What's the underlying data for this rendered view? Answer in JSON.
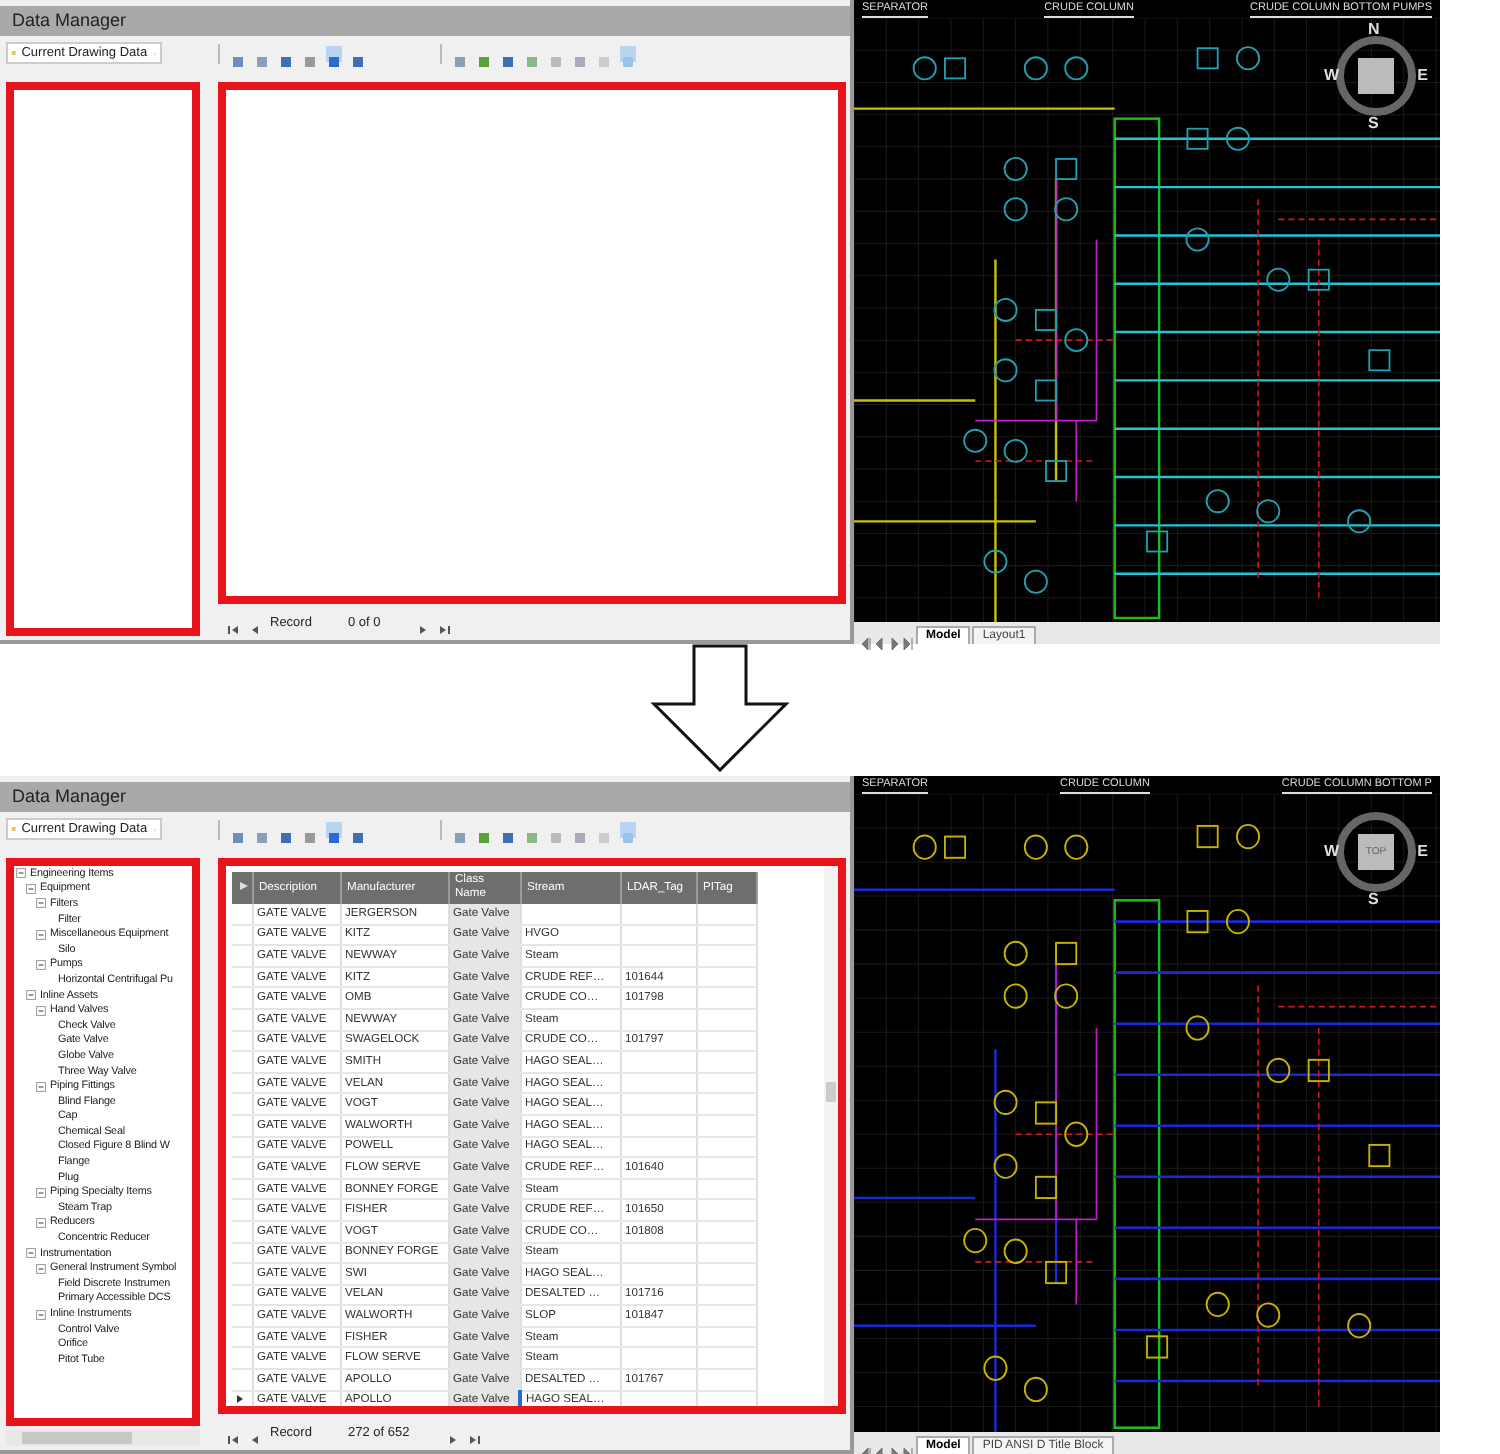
{
  "screens": [
    {
      "window": {
        "title": "Data Manager"
      },
      "source_dropdown": {
        "value": "Current Drawing Data"
      },
      "record_nav": {
        "label": "Record",
        "position": "0 of 0"
      },
      "drawing": {
        "titles": [
          "SEPARATOR",
          "CRUDE COLUMN",
          "CRUDE COLUMN BOTTOM PUMPS"
        ],
        "compass": {
          "n": "N",
          "e": "E",
          "s": "S",
          "w": "W"
        },
        "layout_tabs": [
          {
            "label": "Model",
            "selected": true
          },
          {
            "label": "Layout1",
            "selected": false
          }
        ]
      }
    },
    {
      "window": {
        "title": "Data Manager"
      },
      "source_dropdown": {
        "value": "Current Drawing Data"
      },
      "tree": [
        {
          "label": "Engineering Items",
          "expanded": true,
          "children": [
            {
              "label": "Equipment",
              "expanded": true,
              "children": [
                {
                  "label": "Filters",
                  "expanded": true,
                  "children": [
                    {
                      "label": "Filter"
                    }
                  ]
                },
                {
                  "label": "Miscellaneous Equipment",
                  "expanded": true,
                  "children": [
                    {
                      "label": "Silo"
                    }
                  ]
                },
                {
                  "label": "Pumps",
                  "expanded": true,
                  "children": [
                    {
                      "label": "Horizontal Centrifugal Pu"
                    }
                  ]
                }
              ]
            },
            {
              "label": "Inline Assets",
              "expanded": true,
              "children": [
                {
                  "label": "Hand Valves",
                  "expanded": true,
                  "children": [
                    {
                      "label": "Check Valve"
                    },
                    {
                      "label": "Gate Valve"
                    },
                    {
                      "label": "Globe Valve"
                    },
                    {
                      "label": "Three Way Valve"
                    }
                  ]
                },
                {
                  "label": "Piping Fittings",
                  "expanded": true,
                  "children": [
                    {
                      "label": "Blind Flange"
                    },
                    {
                      "label": "Cap"
                    },
                    {
                      "label": "Chemical Seal"
                    },
                    {
                      "label": "Closed Figure 8 Blind W"
                    },
                    {
                      "label": "Flange"
                    },
                    {
                      "label": "Plug"
                    }
                  ]
                },
                {
                  "label": "Piping Specialty Items",
                  "expanded": true,
                  "children": [
                    {
                      "label": "Steam Trap"
                    }
                  ]
                },
                {
                  "label": "Reducers",
                  "expanded": true,
                  "children": [
                    {
                      "label": "Concentric Reducer"
                    }
                  ]
                }
              ]
            },
            {
              "label": "Instrumentation",
              "expanded": true,
              "children": [
                {
                  "label": "General Instrument Symbol",
                  "expanded": true,
                  "children": [
                    {
                      "label": "Field Discrete Instrumen"
                    },
                    {
                      "label": "Primary Accessible DCS"
                    }
                  ]
                },
                {
                  "label": "Inline Instruments",
                  "expanded": true,
                  "children": [
                    {
                      "label": "Control Valve"
                    },
                    {
                      "label": "Orifice"
                    },
                    {
                      "label": "Pitot Tube"
                    }
                  ]
                }
              ]
            }
          ]
        }
      ],
      "table": {
        "columns": [
          "Description",
          "Manufacturer",
          "Class Name",
          "Stream",
          "LDAR_Tag",
          "PITag"
        ],
        "rows": [
          {
            "cells": [
              "GATE VALVE",
              "JERGERSON",
              "Gate Valve",
              "",
              "",
              ""
            ],
            "selected": false
          },
          {
            "cells": [
              "GATE VALVE",
              "KITZ",
              "Gate Valve",
              "HVGO",
              "",
              ""
            ],
            "selected": false
          },
          {
            "cells": [
              "GATE VALVE",
              "NEWWAY",
              "Gate Valve",
              "Steam",
              "",
              ""
            ],
            "selected": false
          },
          {
            "cells": [
              "GATE VALVE",
              "KITZ",
              "Gate Valve",
              "CRUDE REF…",
              "101644",
              ""
            ],
            "selected": false
          },
          {
            "cells": [
              "GATE VALVE",
              "OMB",
              "Gate Valve",
              "CRUDE CO…",
              "101798",
              ""
            ],
            "selected": false
          },
          {
            "cells": [
              "GATE VALVE",
              "NEWWAY",
              "Gate Valve",
              "Steam",
              "",
              ""
            ],
            "selected": false
          },
          {
            "cells": [
              "GATE VALVE",
              "SWAGELOCK",
              "Gate Valve",
              "CRUDE CO…",
              "101797",
              ""
            ],
            "selected": false
          },
          {
            "cells": [
              "GATE VALVE",
              "SMITH",
              "Gate Valve",
              "HAGO SEAL…",
              "",
              ""
            ],
            "selected": false
          },
          {
            "cells": [
              "GATE VALVE",
              "VELAN",
              "Gate Valve",
              "HAGO SEAL…",
              "",
              ""
            ],
            "selected": false
          },
          {
            "cells": [
              "GATE VALVE",
              "VOGT",
              "Gate Valve",
              "HAGO SEAL…",
              "",
              ""
            ],
            "selected": false
          },
          {
            "cells": [
              "GATE VALVE",
              "WALWORTH",
              "Gate Valve",
              "HAGO SEAL…",
              "",
              ""
            ],
            "selected": false
          },
          {
            "cells": [
              "GATE VALVE",
              "POWELL",
              "Gate Valve",
              "HAGO SEAL…",
              "",
              ""
            ],
            "selected": false
          },
          {
            "cells": [
              "GATE VALVE",
              "FLOW SERVE",
              "Gate Valve",
              "CRUDE REF…",
              "101640",
              ""
            ],
            "selected": false
          },
          {
            "cells": [
              "GATE VALVE",
              "BONNEY FORGE",
              "Gate Valve",
              "Steam",
              "",
              ""
            ],
            "selected": false
          },
          {
            "cells": [
              "GATE VALVE",
              "FISHER",
              "Gate Valve",
              "CRUDE REF…",
              "101650",
              ""
            ],
            "selected": false
          },
          {
            "cells": [
              "GATE VALVE",
              "VOGT",
              "Gate Valve",
              "CRUDE CO…",
              "101808",
              ""
            ],
            "selected": false
          },
          {
            "cells": [
              "GATE VALVE",
              "BONNEY FORGE",
              "Gate Valve",
              "Steam",
              "",
              ""
            ],
            "selected": false
          },
          {
            "cells": [
              "GATE VALVE",
              "SWI",
              "Gate Valve",
              "HAGO SEAL…",
              "",
              ""
            ],
            "selected": false
          },
          {
            "cells": [
              "GATE VALVE",
              "VELAN",
              "Gate Valve",
              "DESALTED …",
              "101716",
              ""
            ],
            "selected": false
          },
          {
            "cells": [
              "GATE VALVE",
              "WALWORTH",
              "Gate Valve",
              "SLOP",
              "101847",
              ""
            ],
            "selected": false
          },
          {
            "cells": [
              "GATE VALVE",
              "FISHER",
              "Gate Valve",
              "Steam",
              "",
              ""
            ],
            "selected": false
          },
          {
            "cells": [
              "GATE VALVE",
              "FLOW SERVE",
              "Gate Valve",
              "Steam",
              "",
              ""
            ],
            "selected": false
          },
          {
            "cells": [
              "GATE VALVE",
              "APOLLO",
              "Gate Valve",
              "DESALTED …",
              "101767",
              ""
            ],
            "selected": false
          },
          {
            "cells": [
              "GATE VALVE",
              "APOLLO",
              "Gate Valve",
              "HAGO SEAL…",
              "",
              ""
            ],
            "selected": true
          }
        ]
      },
      "record_nav": {
        "label": "Record",
        "position": "272 of 652"
      },
      "drawing": {
        "titles": [
          "SEPARATOR",
          "CRUDE COLUMN",
          "CRUDE COLUMN BOTTOM P"
        ],
        "compass": {
          "e": "E",
          "s": "S",
          "w": "W",
          "center": "TOP"
        },
        "layout_tabs": [
          {
            "label": "Model",
            "selected": true
          },
          {
            "label": "PID ANSI D Title Block",
            "selected": false
          }
        ]
      }
    }
  ]
}
